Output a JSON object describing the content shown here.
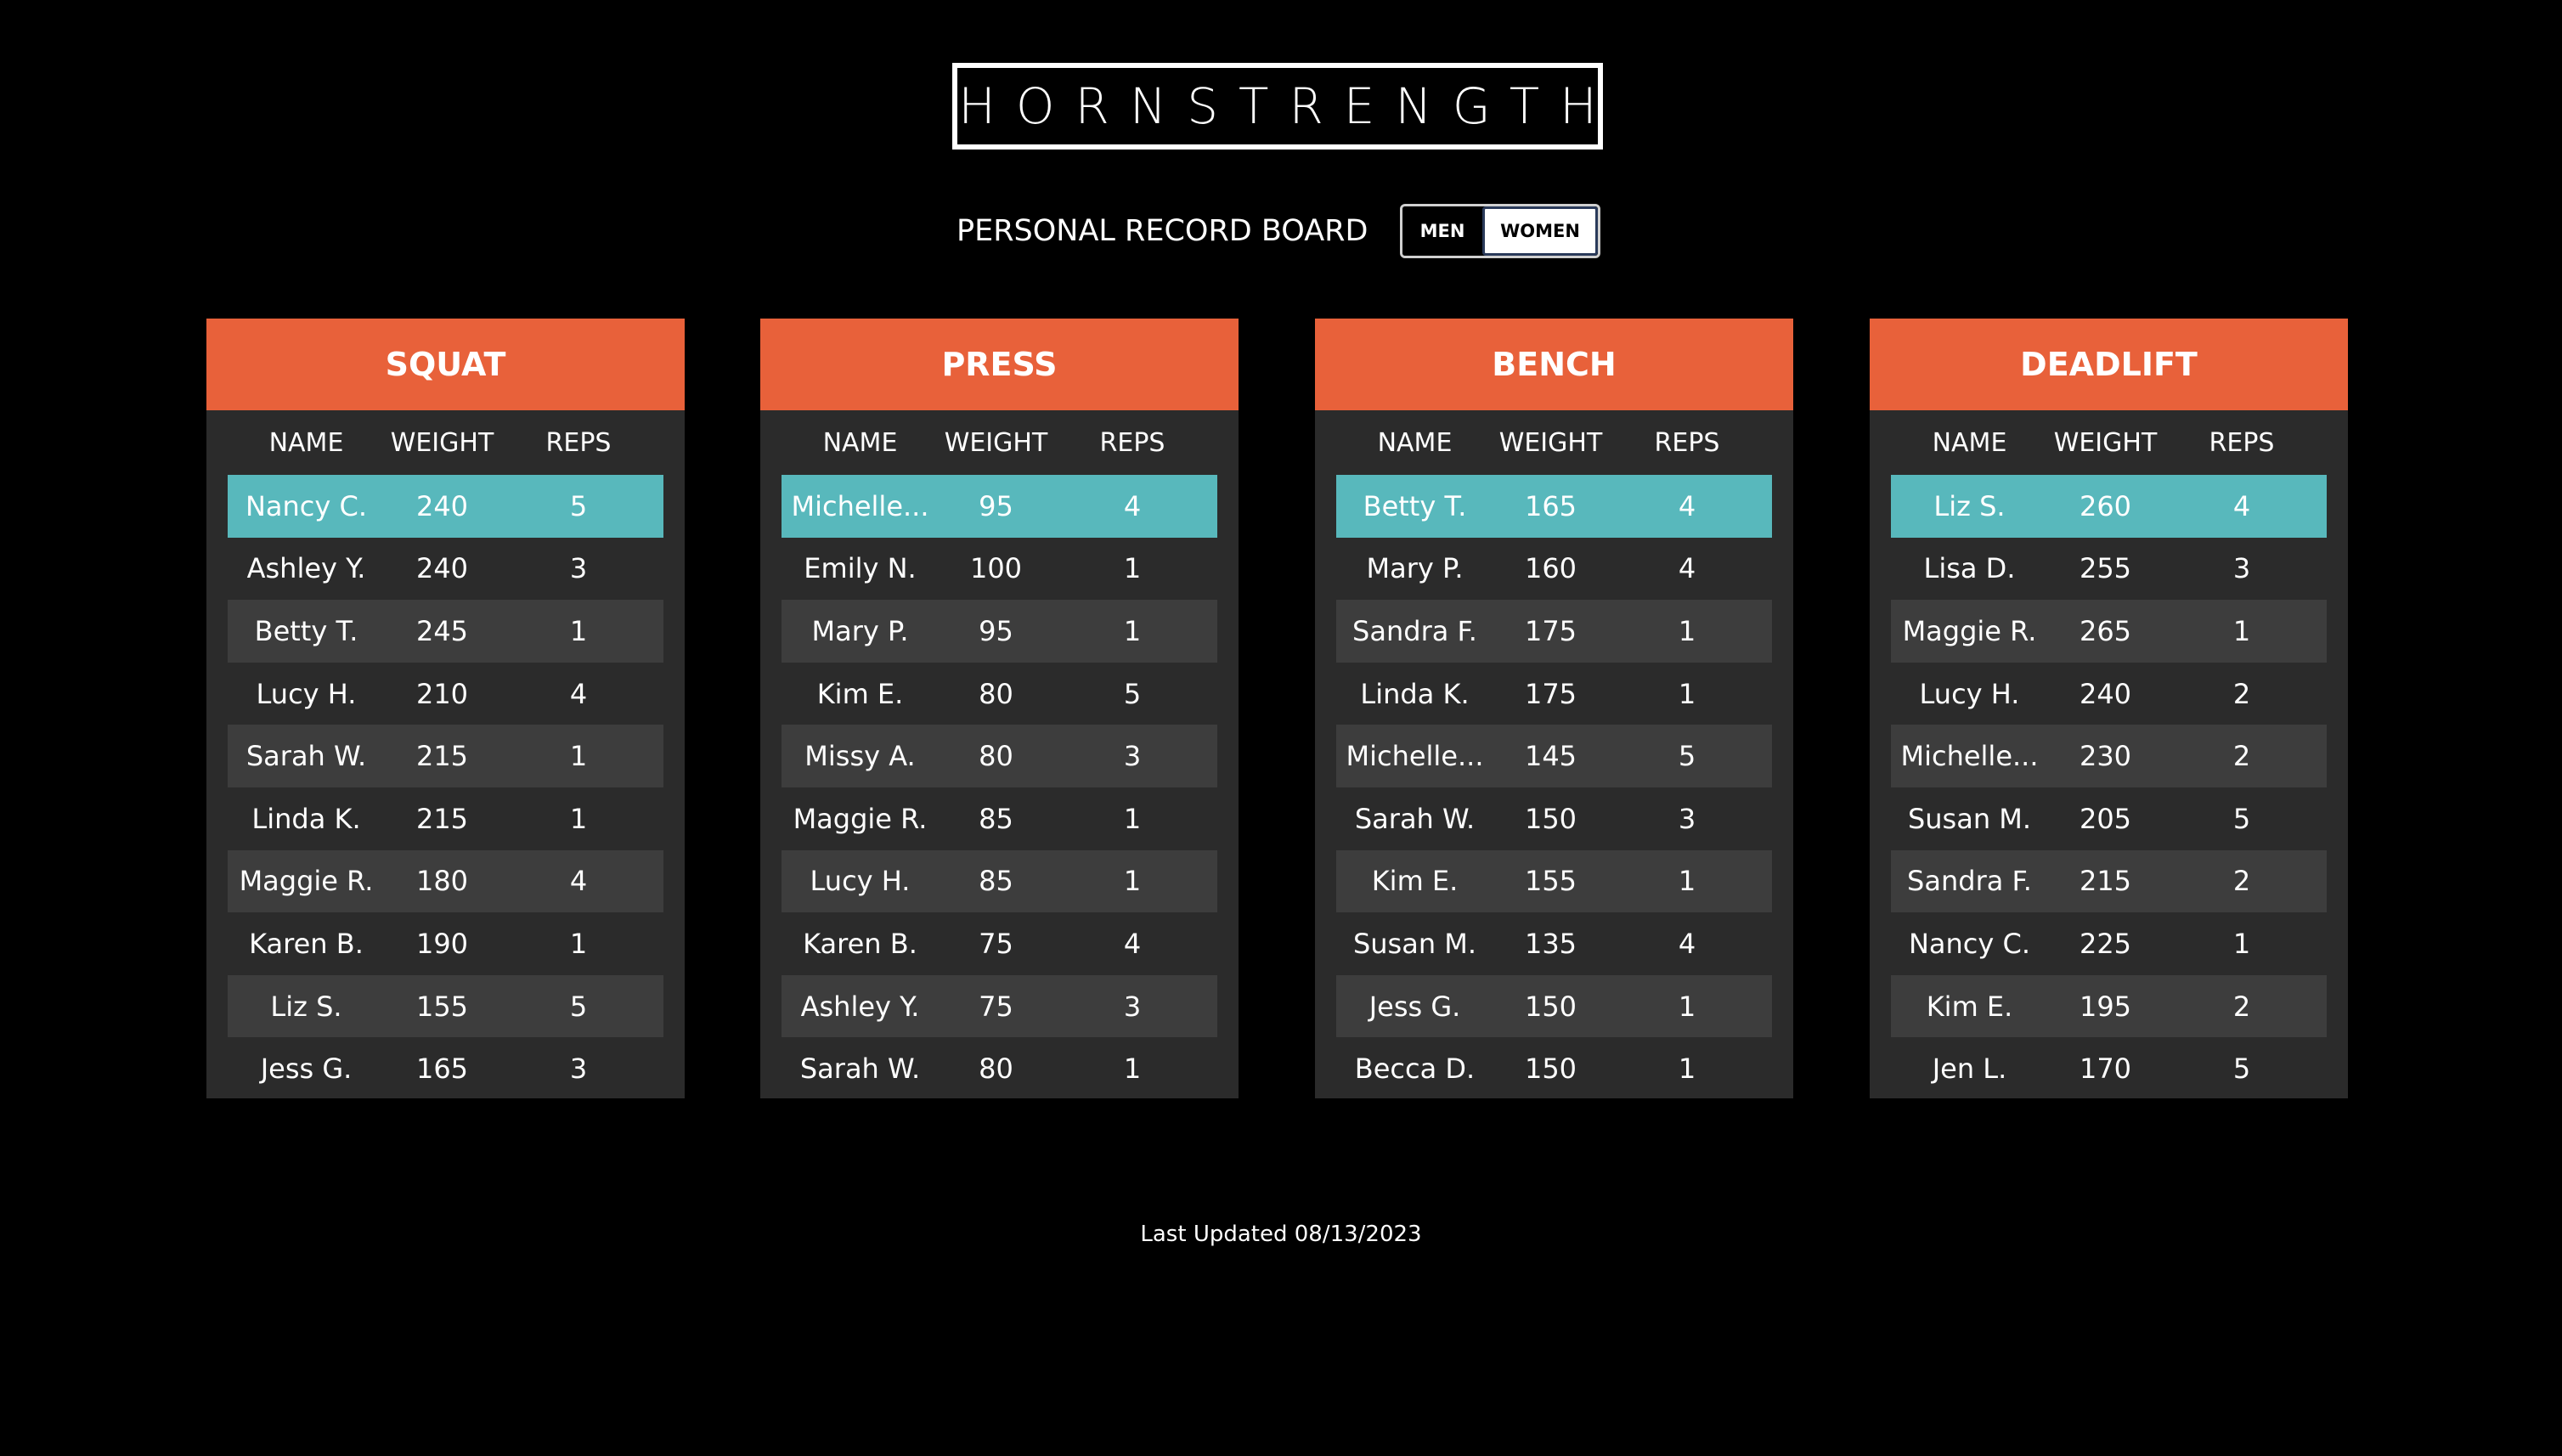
{
  "brand": {
    "logo_text": "HORNSTRENGTH"
  },
  "header": {
    "board_title": "PERSONAL RECORD BOARD"
  },
  "toggle": {
    "men_label": "MEN",
    "women_label": "WOMEN",
    "selected": "WOMEN"
  },
  "columns": {
    "name": "NAME",
    "weight": "WEIGHT",
    "reps": "REPS"
  },
  "colors": {
    "accent": "#e8613a",
    "highlight": "#58b8bc",
    "card": "#2b2b2b",
    "row_alt": "#3d3d3d"
  },
  "lifts": [
    {
      "title": "SQUAT",
      "rows": [
        {
          "name": "Nancy C.",
          "weight": "240",
          "reps": "5"
        },
        {
          "name": "Ashley Y.",
          "weight": "240",
          "reps": "3"
        },
        {
          "name": "Betty T.",
          "weight": "245",
          "reps": "1"
        },
        {
          "name": "Lucy H.",
          "weight": "210",
          "reps": "4"
        },
        {
          "name": "Sarah W.",
          "weight": "215",
          "reps": "1"
        },
        {
          "name": "Linda K.",
          "weight": "215",
          "reps": "1"
        },
        {
          "name": "Maggie R.",
          "weight": "180",
          "reps": "4"
        },
        {
          "name": "Karen B.",
          "weight": "190",
          "reps": "1"
        },
        {
          "name": "Liz S.",
          "weight": "155",
          "reps": "5"
        },
        {
          "name": "Jess G.",
          "weight": "165",
          "reps": "3"
        }
      ]
    },
    {
      "title": "PRESS",
      "rows": [
        {
          "name": "Michelle...",
          "weight": "95",
          "reps": "4"
        },
        {
          "name": "Emily N.",
          "weight": "100",
          "reps": "1"
        },
        {
          "name": "Mary P.",
          "weight": "95",
          "reps": "1"
        },
        {
          "name": "Kim E.",
          "weight": "80",
          "reps": "5"
        },
        {
          "name": "Missy A.",
          "weight": "80",
          "reps": "3"
        },
        {
          "name": "Maggie R.",
          "weight": "85",
          "reps": "1"
        },
        {
          "name": "Lucy H.",
          "weight": "85",
          "reps": "1"
        },
        {
          "name": "Karen B.",
          "weight": "75",
          "reps": "4"
        },
        {
          "name": "Ashley Y.",
          "weight": "75",
          "reps": "3"
        },
        {
          "name": "Sarah W.",
          "weight": "80",
          "reps": "1"
        }
      ]
    },
    {
      "title": "BENCH",
      "rows": [
        {
          "name": "Betty T.",
          "weight": "165",
          "reps": "4"
        },
        {
          "name": "Mary P.",
          "weight": "160",
          "reps": "4"
        },
        {
          "name": "Sandra F.",
          "weight": "175",
          "reps": "1"
        },
        {
          "name": "Linda K.",
          "weight": "175",
          "reps": "1"
        },
        {
          "name": "Michelle...",
          "weight": "145",
          "reps": "5"
        },
        {
          "name": "Sarah W.",
          "weight": "150",
          "reps": "3"
        },
        {
          "name": "Kim E.",
          "weight": "155",
          "reps": "1"
        },
        {
          "name": "Susan M.",
          "weight": "135",
          "reps": "4"
        },
        {
          "name": "Jess G.",
          "weight": "150",
          "reps": "1"
        },
        {
          "name": "Becca D.",
          "weight": "150",
          "reps": "1"
        }
      ]
    },
    {
      "title": "DEADLIFT",
      "rows": [
        {
          "name": "Liz S.",
          "weight": "260",
          "reps": "4"
        },
        {
          "name": "Lisa D.",
          "weight": "255",
          "reps": "3"
        },
        {
          "name": "Maggie R.",
          "weight": "265",
          "reps": "1"
        },
        {
          "name": "Lucy H.",
          "weight": "240",
          "reps": "2"
        },
        {
          "name": "Michelle...",
          "weight": "230",
          "reps": "2"
        },
        {
          "name": "Susan M.",
          "weight": "205",
          "reps": "5"
        },
        {
          "name": "Sandra F.",
          "weight": "215",
          "reps": "2"
        },
        {
          "name": "Nancy C.",
          "weight": "225",
          "reps": "1"
        },
        {
          "name": "Kim E.",
          "weight": "195",
          "reps": "2"
        },
        {
          "name": "Jen L.",
          "weight": "170",
          "reps": "5"
        }
      ]
    }
  ],
  "footer": {
    "last_updated": "Last Updated 08/13/2023"
  }
}
